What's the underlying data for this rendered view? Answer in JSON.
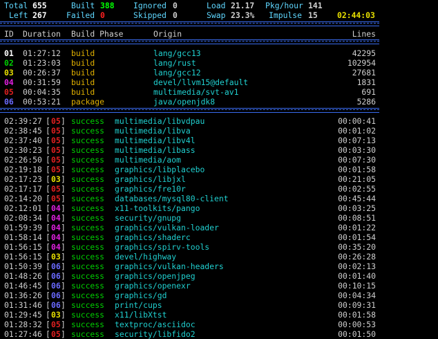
{
  "summary": {
    "row1": [
      {
        "label": "Total",
        "value": "655",
        "color": "#ffffff"
      },
      {
        "label": "Built",
        "value": "388",
        "color": "#00ff00"
      },
      {
        "label": "Ignored",
        "value": "0",
        "color": "#d0d0d0"
      },
      {
        "label": "Load",
        "value": "21.17",
        "color": "#d0d0d0"
      },
      {
        "label": "Pkg/hour",
        "value": "141",
        "color": "#d0d0d0"
      }
    ],
    "row2": [
      {
        "label": "Left",
        "value": "267",
        "color": "#ffffff"
      },
      {
        "label": "Failed",
        "value": "0",
        "color": "#ff2020"
      },
      {
        "label": "Skipped",
        "value": "0",
        "color": "#d0d0d0"
      },
      {
        "label": "Swap",
        "value": "23.3%",
        "color": "#d0d0d0"
      },
      {
        "label": "Impulse",
        "value": "15",
        "color": "#d0d0d0"
      }
    ],
    "elapsed": "02:44:03"
  },
  "header": {
    "id": "ID",
    "duration": "Duration",
    "phase": "Build Phase",
    "origin": "Origin",
    "lines": "Lines"
  },
  "builders": [
    {
      "id": "01",
      "color": "#ffffff",
      "duration": "01:27:12",
      "phase": "build",
      "origin": "lang/gcc13",
      "lines": "42295"
    },
    {
      "id": "02",
      "color": "#00d000",
      "duration": "01:23:03",
      "phase": "build",
      "origin": "lang/rust",
      "lines": "102954"
    },
    {
      "id": "03",
      "color": "#e8e000",
      "duration": "00:26:37",
      "phase": "build",
      "origin": "lang/gcc12",
      "lines": "27681"
    },
    {
      "id": "04",
      "color": "#e020e0",
      "duration": "00:31:59",
      "phase": "build",
      "origin": "devel/llvm15@default",
      "lines": "1831"
    },
    {
      "id": "05",
      "color": "#e02020",
      "duration": "00:04:35",
      "phase": "build",
      "origin": "multimedia/svt-av1",
      "lines": "691"
    },
    {
      "id": "06",
      "color": "#6a6aff",
      "duration": "00:53:21",
      "phase": "package",
      "origin": "java/openjdk8",
      "lines": "5286"
    }
  ],
  "log": [
    {
      "time": "02:39:27",
      "id": "05",
      "color": "#e02020",
      "status": "success",
      "origin": "multimedia/libvdpau",
      "duration": "00:00:41"
    },
    {
      "time": "02:38:45",
      "id": "05",
      "color": "#e02020",
      "status": "success",
      "origin": "multimedia/libva",
      "duration": "00:01:02"
    },
    {
      "time": "02:37:40",
      "id": "05",
      "color": "#e02020",
      "status": "success",
      "origin": "multimedia/libv4l",
      "duration": "00:07:13"
    },
    {
      "time": "02:30:23",
      "id": "05",
      "color": "#e02020",
      "status": "success",
      "origin": "multimedia/libass",
      "duration": "00:03:30"
    },
    {
      "time": "02:26:50",
      "id": "05",
      "color": "#e02020",
      "status": "success",
      "origin": "multimedia/aom",
      "duration": "00:07:30"
    },
    {
      "time": "02:19:18",
      "id": "05",
      "color": "#e02020",
      "status": "success",
      "origin": "graphics/libplacebo",
      "duration": "00:01:58"
    },
    {
      "time": "02:17:23",
      "id": "03",
      "color": "#e8e000",
      "status": "success",
      "origin": "graphics/libjxl",
      "duration": "00:21:05"
    },
    {
      "time": "02:17:17",
      "id": "05",
      "color": "#e02020",
      "status": "success",
      "origin": "graphics/fre10r",
      "duration": "00:02:55"
    },
    {
      "time": "02:14:20",
      "id": "05",
      "color": "#e02020",
      "status": "success",
      "origin": "databases/mysql80-client",
      "duration": "00:45:44"
    },
    {
      "time": "02:12:01",
      "id": "04",
      "color": "#e020e0",
      "status": "success",
      "origin": "x11-toolkits/pango",
      "duration": "00:03:25"
    },
    {
      "time": "02:08:34",
      "id": "04",
      "color": "#e020e0",
      "status": "success",
      "origin": "security/gnupg",
      "duration": "00:08:51"
    },
    {
      "time": "01:59:39",
      "id": "04",
      "color": "#e020e0",
      "status": "success",
      "origin": "graphics/vulkan-loader",
      "duration": "00:01:22"
    },
    {
      "time": "01:58:14",
      "id": "04",
      "color": "#e020e0",
      "status": "success",
      "origin": "graphics/shaderc",
      "duration": "00:01:54"
    },
    {
      "time": "01:56:15",
      "id": "04",
      "color": "#e020e0",
      "status": "success",
      "origin": "graphics/spirv-tools",
      "duration": "00:35:20"
    },
    {
      "time": "01:56:15",
      "id": "03",
      "color": "#e8e000",
      "status": "success",
      "origin": "devel/highway",
      "duration": "00:26:28"
    },
    {
      "time": "01:50:39",
      "id": "06",
      "color": "#6a6aff",
      "status": "success",
      "origin": "graphics/vulkan-headers",
      "duration": "00:02:13"
    },
    {
      "time": "01:48:26",
      "id": "06",
      "color": "#6a6aff",
      "status": "success",
      "origin": "graphics/openjpeg",
      "duration": "00:01:40"
    },
    {
      "time": "01:46:45",
      "id": "06",
      "color": "#6a6aff",
      "status": "success",
      "origin": "graphics/openexr",
      "duration": "00:10:15"
    },
    {
      "time": "01:36:26",
      "id": "06",
      "color": "#6a6aff",
      "status": "success",
      "origin": "graphics/gd",
      "duration": "00:04:34"
    },
    {
      "time": "01:31:46",
      "id": "06",
      "color": "#6a6aff",
      "status": "success",
      "origin": "print/cups",
      "duration": "00:09:31"
    },
    {
      "time": "01:29:45",
      "id": "03",
      "color": "#e8e000",
      "status": "success",
      "origin": "x11/libXtst",
      "duration": "00:01:58"
    },
    {
      "time": "01:28:32",
      "id": "05",
      "color": "#e02020",
      "status": "success",
      "origin": "textproc/asciidoc",
      "duration": "00:00:53"
    },
    {
      "time": "01:27:46",
      "id": "05",
      "color": "#e02020",
      "status": "success",
      "origin": "security/libfido2",
      "duration": "00:01:50"
    }
  ],
  "colors": {
    "label": "#5fd7ff",
    "origin": "#20d0d0",
    "phase": "#e0b000",
    "success": "#00d000",
    "separator": "#3a6cf0"
  }
}
